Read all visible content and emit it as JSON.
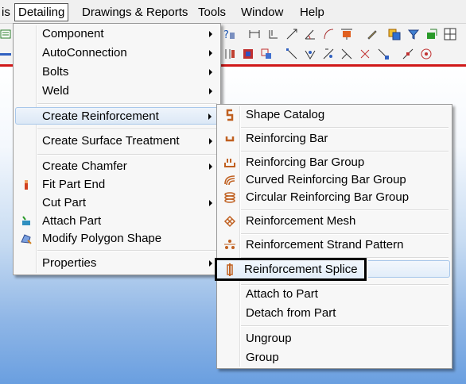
{
  "menubar": {
    "items": [
      {
        "label": "is"
      },
      {
        "label": "Detailing"
      },
      {
        "label": "Drawings & Reports"
      },
      {
        "label": "Tools"
      },
      {
        "label": "Window"
      },
      {
        "label": "Help"
      }
    ]
  },
  "detailing_menu": {
    "items": [
      {
        "label": "Component"
      },
      {
        "label": "AutoConnection"
      },
      {
        "label": "Bolts"
      },
      {
        "label": "Weld"
      },
      {
        "label": "Create Reinforcement"
      },
      {
        "label": "Create Surface Treatment"
      },
      {
        "label": "Create Chamfer"
      },
      {
        "label": "Fit Part End"
      },
      {
        "label": "Cut Part"
      },
      {
        "label": "Attach Part"
      },
      {
        "label": "Modify Polygon Shape"
      },
      {
        "label": "Properties"
      }
    ]
  },
  "reinforcement_menu": {
    "items": [
      {
        "label": "Shape Catalog"
      },
      {
        "label": "Reinforcing Bar"
      },
      {
        "label": "Reinforcing Bar Group"
      },
      {
        "label": "Curved Reinforcing Bar Group"
      },
      {
        "label": "Circular Reinforcing Bar Group"
      },
      {
        "label": "Reinforcement Mesh"
      },
      {
        "label": "Reinforcement Strand Pattern"
      },
      {
        "label": "Reinforcement Splice"
      },
      {
        "label": "Attach to Part"
      },
      {
        "label": "Detach from Part"
      },
      {
        "label": "Ungroup"
      },
      {
        "label": "Group"
      }
    ]
  },
  "colors": {
    "accent_red": "#d01818",
    "highlight_border": "#a8c7ea"
  }
}
